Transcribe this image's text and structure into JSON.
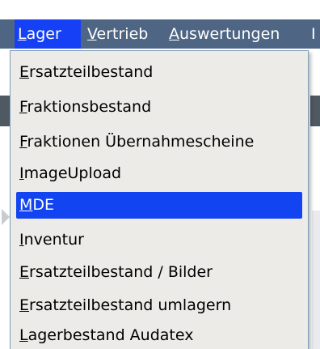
{
  "menubar": {
    "items": [
      {
        "mnemonic": "L",
        "rest": "ager",
        "active": true
      },
      {
        "mnemonic": "V",
        "rest": "ertrieb",
        "active": false
      },
      {
        "mnemonic": "A",
        "rest": "uswertungen",
        "active": false
      },
      {
        "mnemonic": "",
        "rest": "I",
        "active": false
      }
    ]
  },
  "dropdown": {
    "items": [
      {
        "mnemonic": "E",
        "rest": "rsatzteilbestand",
        "selected": false
      },
      {
        "mnemonic": "F",
        "rest": "raktionsbestand",
        "selected": false
      },
      {
        "mnemonic": "F",
        "rest": "raktionen Übernahmescheine",
        "selected": false
      },
      {
        "mnemonic": "I",
        "rest": "mageUpload",
        "selected": false
      },
      {
        "mnemonic": "M",
        "rest": "DE",
        "selected": true
      },
      {
        "mnemonic": "I",
        "rest": "nventur",
        "selected": false
      },
      {
        "mnemonic": "E",
        "rest": "rsatzteilbestand / Bilder",
        "selected": false
      },
      {
        "mnemonic": "E",
        "rest": "rsatzteilbestand umlagern",
        "selected": false
      },
      {
        "mnemonic": "L",
        "rest": "agerbestand Audatex",
        "selected": false
      }
    ]
  },
  "colors": {
    "menubar_bg": "#4e6684",
    "selection": "#1244f2",
    "menu_bg": "#ecebe8"
  }
}
